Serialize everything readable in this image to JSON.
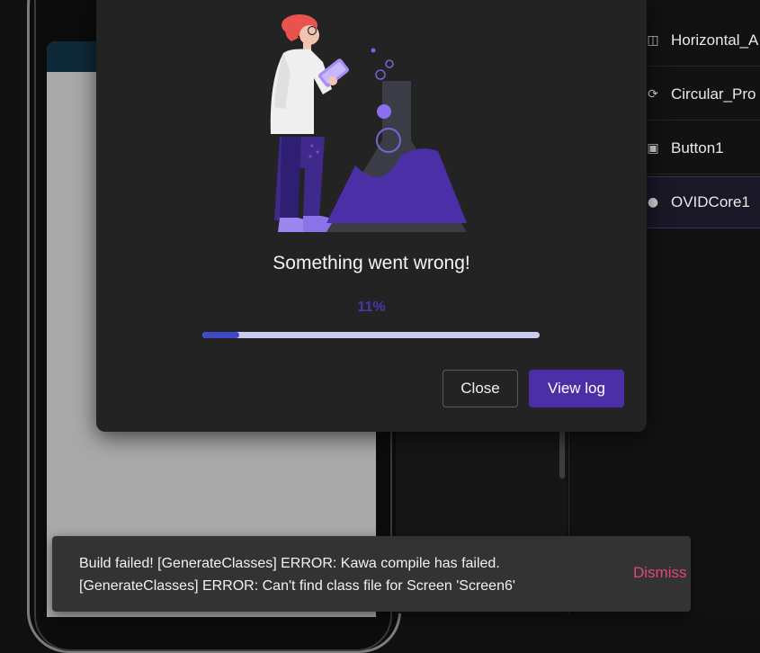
{
  "components": [
    {
      "label": "Horizontal_A",
      "icon": "horizontal-arrangement-icon"
    },
    {
      "label": "Circular_Pro",
      "icon": "circular-progress-icon"
    },
    {
      "label": "Button1",
      "icon": "button-icon"
    },
    {
      "label": "OVIDCore1",
      "icon": "extension-icon",
      "selected": true
    }
  ],
  "dialog": {
    "title": "Something went wrong!",
    "progress_text": "11%",
    "progress_value": 0.11,
    "close_label": "Close",
    "viewlog_label": "View log"
  },
  "snackbar": {
    "line1": "Build failed! [GenerateClasses] ERROR: Kawa compile has failed.",
    "line2": "[GenerateClasses] ERROR: Can't find class file for Screen 'Screen6'",
    "dismiss_label": "Dismiss"
  },
  "colors": {
    "accent": "#4a2fa6",
    "progress_fill": "#3f49c6",
    "progress_track": "#c9ccee",
    "dismiss": "#e4457a"
  }
}
